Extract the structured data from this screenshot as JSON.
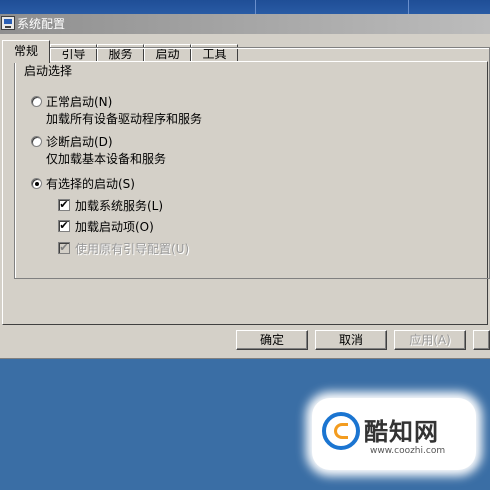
{
  "window": {
    "title": "系统配置"
  },
  "tabs": [
    {
      "label": "常规",
      "active": true
    },
    {
      "label": "引导",
      "active": false
    },
    {
      "label": "服务",
      "active": false
    },
    {
      "label": "启动",
      "active": false
    },
    {
      "label": "工具",
      "active": false
    }
  ],
  "startup": {
    "group_label": "启动选择",
    "normal": {
      "label": "正常启动(N)",
      "description": "加载所有设备驱动程序和服务",
      "selected": false
    },
    "diagnostic": {
      "label": "诊断启动(D)",
      "description": "仅加载基本设备和服务",
      "selected": false
    },
    "selective": {
      "label": "有选择的启动(S)",
      "selected": true
    },
    "options": {
      "load_system_services": {
        "label": "加载系统服务(L)",
        "checked": true,
        "enabled": true
      },
      "load_startup_items": {
        "label": "加载启动项(O)",
        "checked": true,
        "enabled": true
      },
      "use_original_boot": {
        "label": "使用原有引导配置(U)",
        "checked": true,
        "enabled": false
      }
    }
  },
  "buttons": {
    "ok": "确定",
    "cancel": "取消",
    "apply": "应用(A)"
  },
  "watermark": {
    "name": "酷知网",
    "url": "www.coozhi.com"
  },
  "colors": {
    "desktop": "#3a6ea5",
    "dialog_face": "#d4d0c8",
    "watermark_blue": "#1b75d1",
    "watermark_orange": "#f39c1f"
  }
}
